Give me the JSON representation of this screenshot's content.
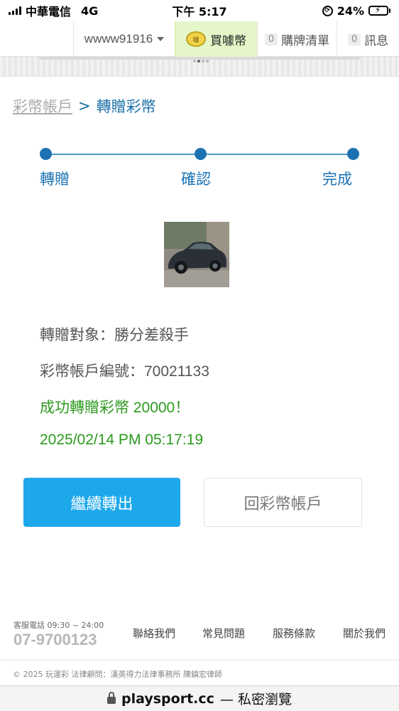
{
  "status_bar": {
    "carrier": "中華電信",
    "network": "4G",
    "time": "下午 5:17",
    "battery": "24%",
    "battery_level": 0.24
  },
  "top_nav": {
    "username": "wwww91916",
    "buy_label": "買噱幣",
    "coin_icon_text": "噱",
    "cart_count": "0",
    "cart_label": "購牌清單",
    "msg_count": "0",
    "msg_label": "訊息"
  },
  "breadcrumb": {
    "parent": "彩幣帳戶",
    "separator": ">",
    "current": "轉贈彩幣"
  },
  "steps": [
    {
      "label": "轉贈"
    },
    {
      "label": "確認"
    },
    {
      "label": "完成"
    }
  ],
  "info": {
    "recipient": "轉贈對象：勝分差殺手",
    "account": "彩幣帳戶編號：70021133",
    "success": "成功轉贈彩幣 20000！",
    "datetime": "2025/02/14 PM 05:17:19"
  },
  "buttons": {
    "continue": "繼續轉出",
    "back": "回彩幣帳戶"
  },
  "footer": {
    "service_label": "客服電話 09:30 ~ 24:00",
    "phone": "07-9700123",
    "links": [
      "聯絡我們",
      "常見問題",
      "服務條款",
      "關於我們"
    ],
    "copyright": "© 2025 玩運彩 法律顧問：漢英得力法律事務所 陳鎮宏律師"
  },
  "browser": {
    "url": "playsport.cc",
    "mode": "— 私密瀏覽"
  }
}
